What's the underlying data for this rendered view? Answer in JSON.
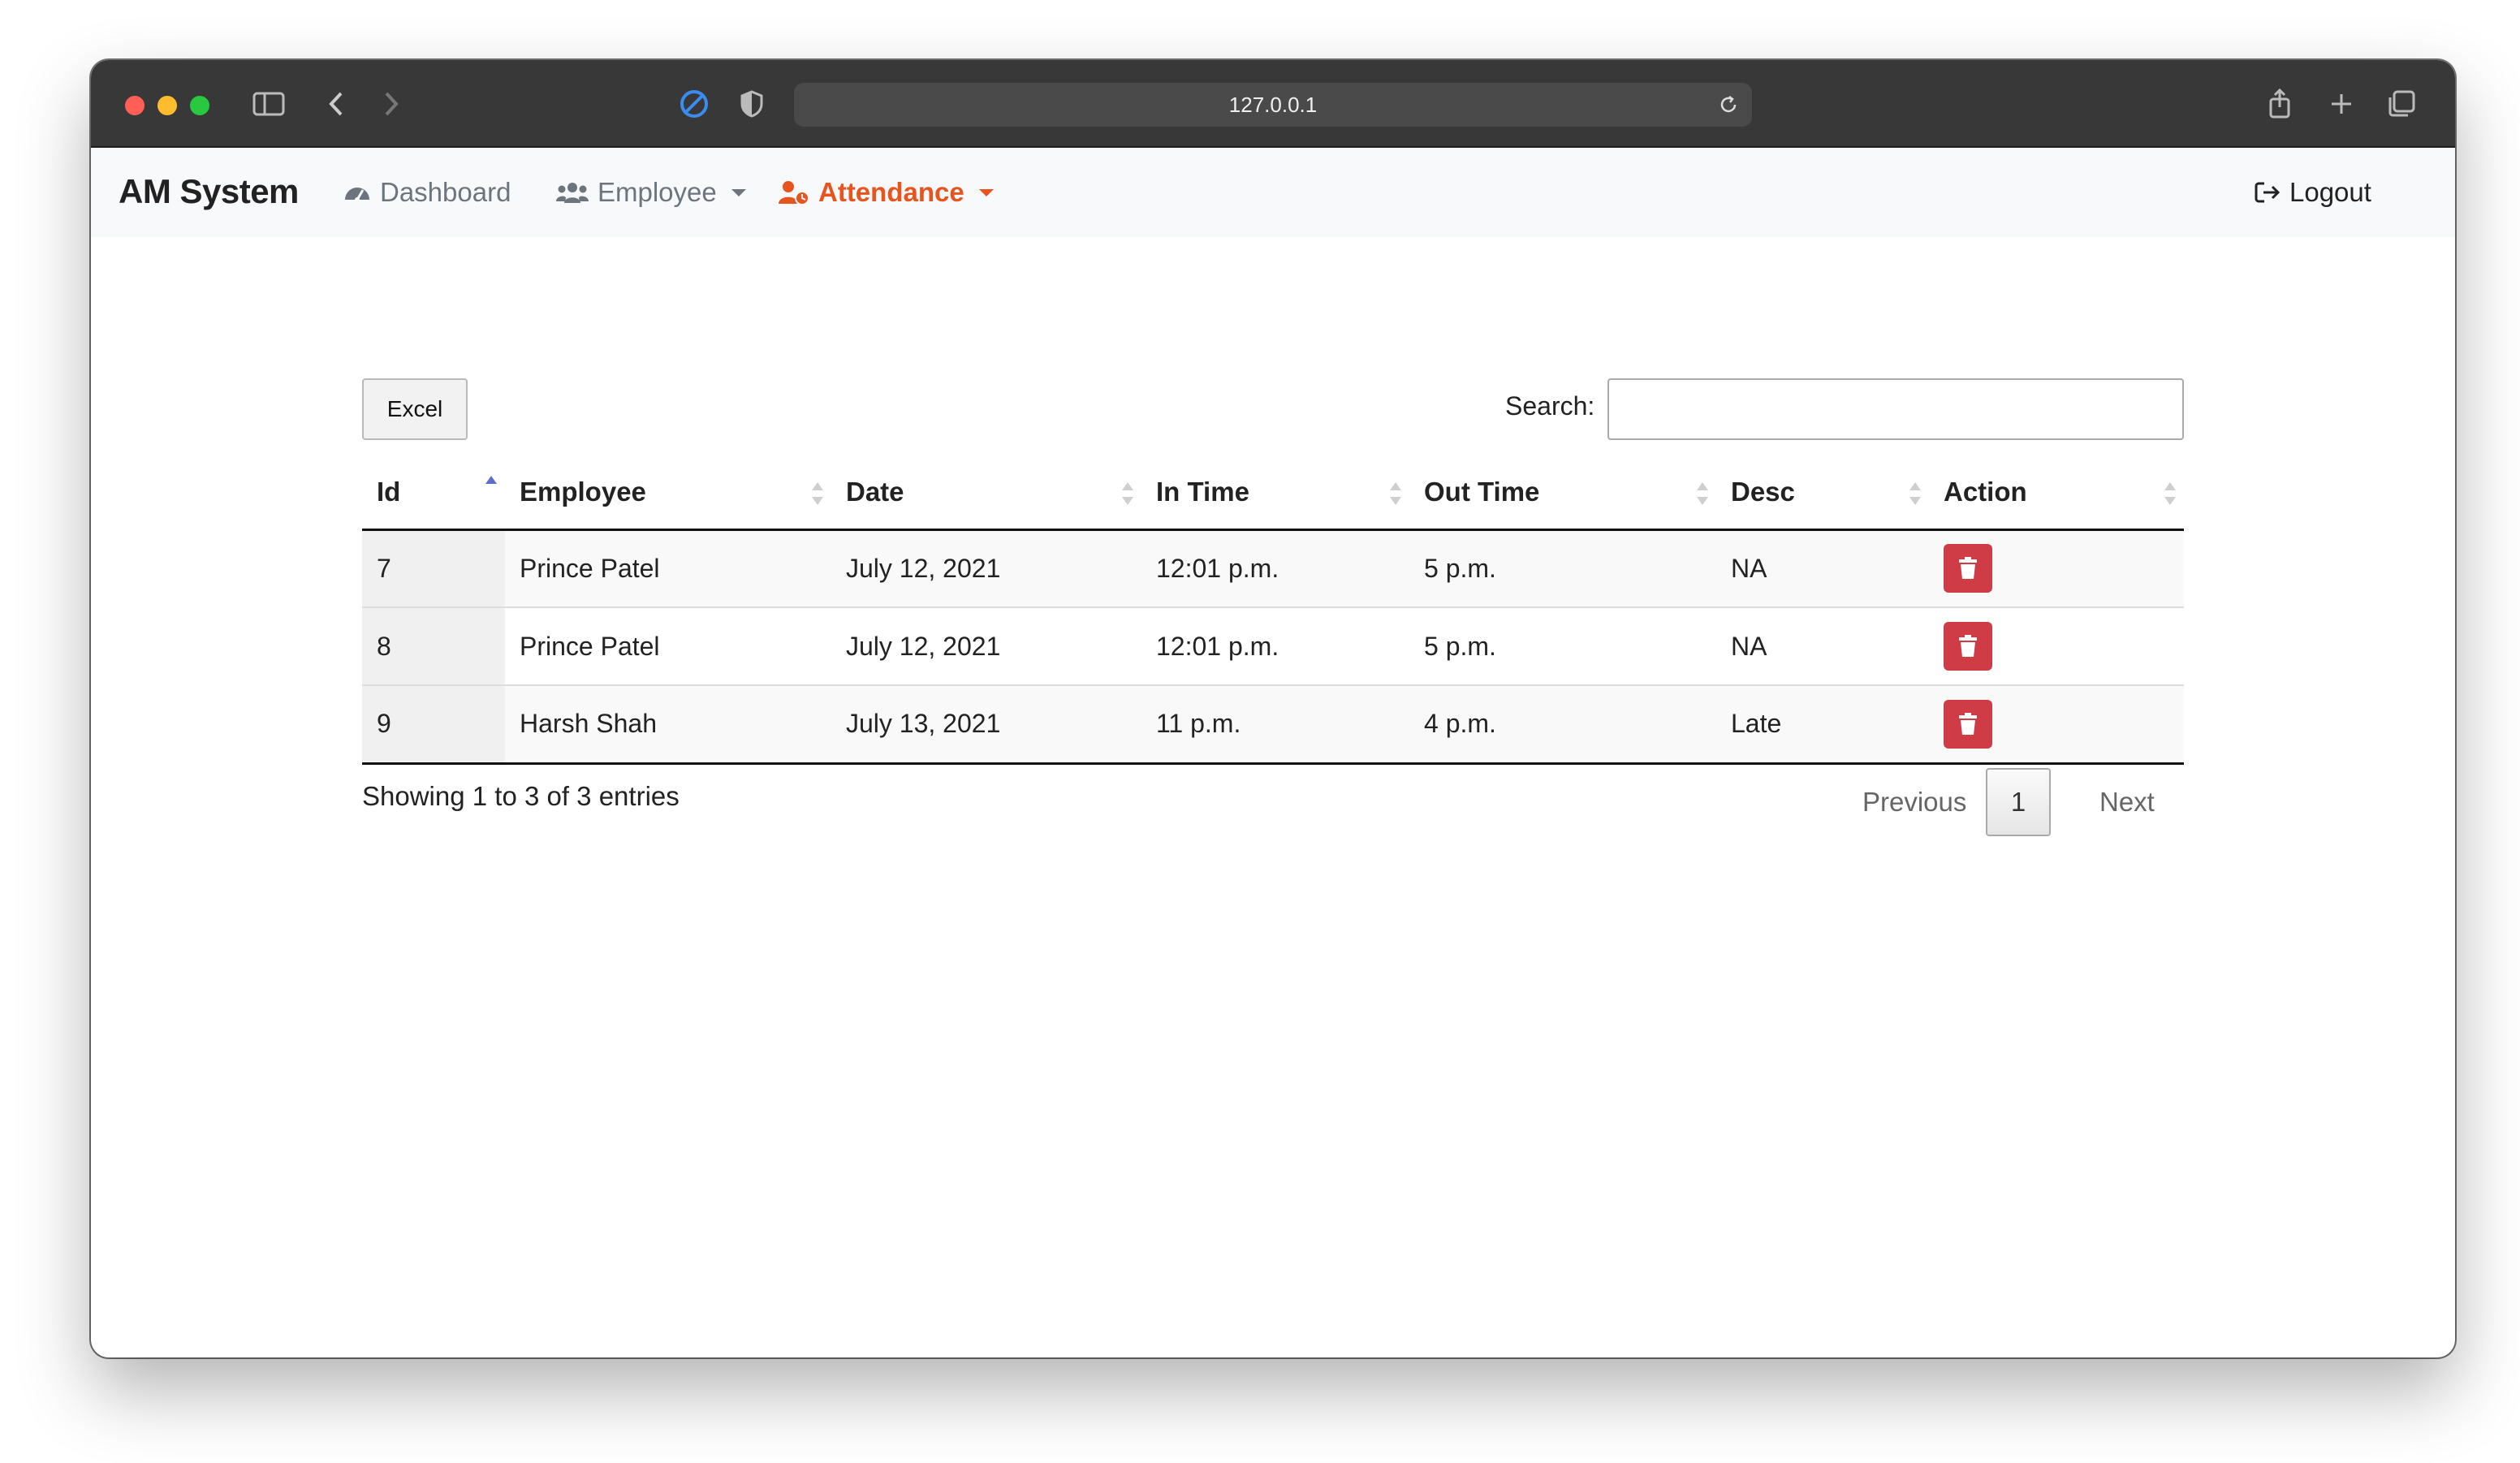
{
  "browser": {
    "url": "127.0.0.1"
  },
  "navbar": {
    "brand": "AM System",
    "items": [
      {
        "label": "Dashboard",
        "icon": "dashboard-gauge-icon"
      },
      {
        "label": "Employee",
        "icon": "users-icon",
        "dropdown": true
      },
      {
        "label": "Attendance",
        "icon": "user-clock-icon",
        "dropdown": true,
        "active": true
      }
    ],
    "logout": "Logout",
    "colors": {
      "active": "#e8541e",
      "inactive": "#6c757d"
    }
  },
  "toolbar": {
    "excel_label": "Excel",
    "search_label": "Search:",
    "search_value": ""
  },
  "table": {
    "columns": [
      "Id",
      "Employee",
      "Date",
      "In Time",
      "Out Time",
      "Desc",
      "Action"
    ],
    "sorted_column": "Id",
    "sort_direction": "ascending",
    "rows": [
      {
        "id": "7",
        "employee": "Prince Patel",
        "date": "July 12, 2021",
        "in_time": "12:01 p.m.",
        "out_time": "5 p.m.",
        "desc": "NA",
        "action": "trash-icon"
      },
      {
        "id": "8",
        "employee": "Prince Patel",
        "date": "July 12, 2021",
        "in_time": "12:01 p.m.",
        "out_time": "5 p.m.",
        "desc": "NA",
        "action": "trash-icon"
      },
      {
        "id": "9",
        "employee": "Harsh Shah",
        "date": "July 13, 2021",
        "in_time": "11 p.m.",
        "out_time": "4 p.m.",
        "desc": "Late",
        "action": "trash-icon"
      }
    ],
    "delete_color": "#d03c45"
  },
  "footer": {
    "info": "Showing 1 to 3 of 3 entries",
    "previous": "Previous",
    "current_page": "1",
    "next": "Next"
  }
}
